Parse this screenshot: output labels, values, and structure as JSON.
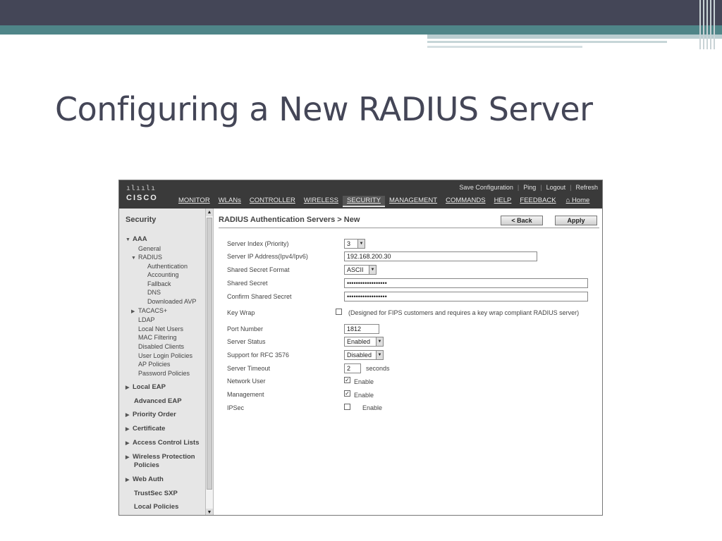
{
  "slide": {
    "title": "Configuring a New RADIUS Server"
  },
  "wlc": {
    "logo": {
      "bars": "ılıılı",
      "word": "CISCO"
    },
    "top_links": [
      "Save Configuration",
      "Ping",
      "Logout",
      "Refresh"
    ],
    "nav": [
      "MONITOR",
      "WLANs",
      "CONTROLLER",
      "WIRELESS",
      "SECURITY",
      "MANAGEMENT",
      "COMMANDS",
      "HELP",
      "FEEDBACK"
    ],
    "home_label": "Home",
    "sidebar": {
      "title": "Security",
      "items": [
        "AAA",
        "General",
        "RADIUS",
        "Authentication",
        "Accounting",
        "Fallback",
        "DNS",
        "Downloaded AVP",
        "TACACS+",
        "LDAP",
        "Local Net Users",
        "MAC Filtering",
        "Disabled Clients",
        "User Login Policies",
        "AP Policies",
        "Password Policies",
        "Local EAP",
        "Advanced EAP",
        "Priority Order",
        "Certificate",
        "Access Control Lists",
        "Wireless Protection",
        "Policies",
        "Web Auth",
        "TrustSec SXP",
        "Local Policies"
      ]
    },
    "breadcrumb": "RADIUS Authentication Servers > New",
    "back_label": "< Back",
    "apply_label": "Apply",
    "form": {
      "labels": [
        "Server Index (Priority)",
        "Server IP Address(Ipv4/Ipv6)",
        "Shared Secret Format",
        "Shared Secret",
        "Confirm Shared Secret",
        "Key Wrap",
        "Port Number",
        "Server Status",
        "Support for RFC 3576",
        "Server Timeout",
        "Network User",
        "Management",
        "IPSec"
      ],
      "server_index": "3",
      "server_ip": "192.168.200.30",
      "secret_format": "ASCII",
      "shared_secret": "••••••••••••••••••",
      "confirm_secret": "••••••••••••••••••",
      "key_wrap_note": "(Designed for FIPS customers and requires a key wrap compliant RADIUS server)",
      "port": "1812",
      "server_status": "Enabled",
      "rfc3576": "Disabled",
      "timeout": "2",
      "seconds_label": "seconds",
      "enable_label": "Enable",
      "network_user_checked": true,
      "management_checked": true,
      "ipsec_checked": false,
      "key_wrap_checked": false
    }
  }
}
